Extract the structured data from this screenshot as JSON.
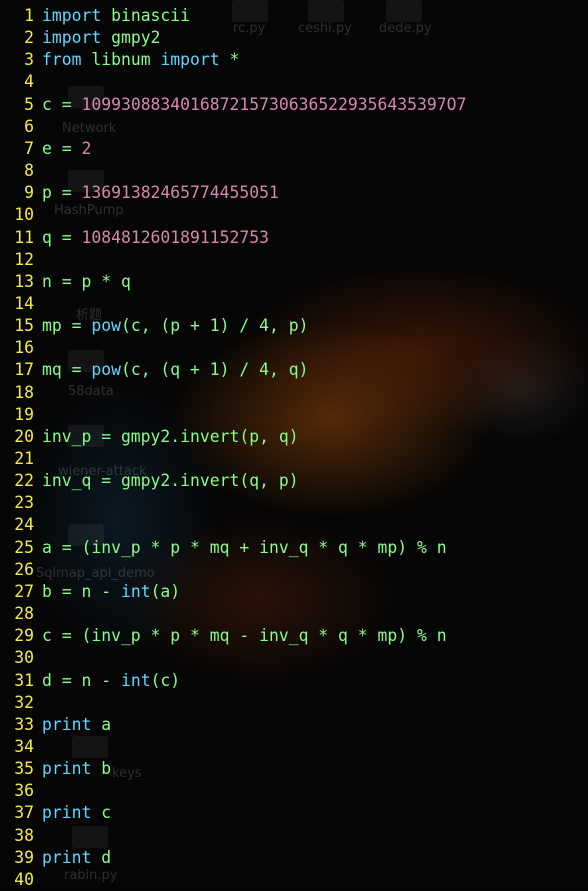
{
  "desktop_icons": [
    "rc.py",
    "ceshi.py",
    "dede.py",
    "Network",
    "HashPump",
    "析题",
    "58data",
    "wiener-attack",
    "Sqlmap_api_demo",
    "keys",
    "rabin.py"
  ],
  "lines": [
    {
      "n": "1",
      "tokens": [
        {
          "t": "import",
          "c": "kw"
        },
        {
          "t": " binascii",
          "c": "mod"
        }
      ]
    },
    {
      "n": "2",
      "tokens": [
        {
          "t": "import",
          "c": "kw"
        },
        {
          "t": " gmpy2",
          "c": "mod"
        }
      ]
    },
    {
      "n": "3",
      "tokens": [
        {
          "t": "from",
          "c": "kw"
        },
        {
          "t": " libnum ",
          "c": "mod"
        },
        {
          "t": "import",
          "c": "kw"
        },
        {
          "t": " *",
          "c": "mod"
        }
      ]
    },
    {
      "n": "4",
      "tokens": []
    },
    {
      "n": "5",
      "tokens": [
        {
          "t": "c = ",
          "c": "op"
        },
        {
          "t": "1099308834016872157306365229356435397O7",
          "c": "num"
        }
      ]
    },
    {
      "n": "6",
      "tokens": []
    },
    {
      "n": "7",
      "tokens": [
        {
          "t": "e = ",
          "c": "op"
        },
        {
          "t": "2",
          "c": "num"
        }
      ]
    },
    {
      "n": "8",
      "tokens": []
    },
    {
      "n": "9",
      "tokens": [
        {
          "t": "p = ",
          "c": "op"
        },
        {
          "t": "13691382465774455051",
          "c": "num"
        }
      ]
    },
    {
      "n": "10",
      "tokens": []
    },
    {
      "n": "11",
      "tokens": [
        {
          "t": "q = ",
          "c": "op"
        },
        {
          "t": "1084812601891152753",
          "c": "num"
        }
      ]
    },
    {
      "n": "12",
      "tokens": []
    },
    {
      "n": "13",
      "tokens": [
        {
          "t": "n = p * q",
          "c": "op"
        }
      ]
    },
    {
      "n": "14",
      "tokens": []
    },
    {
      "n": "15",
      "tokens": [
        {
          "t": "mp = ",
          "c": "op"
        },
        {
          "t": "pow",
          "c": "kw"
        },
        {
          "t": "(c, (p + 1) / 4, p)",
          "c": "op"
        }
      ]
    },
    {
      "n": "16",
      "tokens": []
    },
    {
      "n": "17",
      "tokens": [
        {
          "t": "mq = ",
          "c": "op"
        },
        {
          "t": "pow",
          "c": "kw"
        },
        {
          "t": "(c, (q + 1) / 4, q)",
          "c": "op"
        }
      ]
    },
    {
      "n": "18",
      "tokens": []
    },
    {
      "n": "19",
      "tokens": []
    },
    {
      "n": "20",
      "tokens": [
        {
          "t": "inv_p = gmpy2.invert(p, q)",
          "c": "op"
        }
      ]
    },
    {
      "n": "21",
      "tokens": []
    },
    {
      "n": "22",
      "tokens": [
        {
          "t": "inv_q = gmpy2.invert(q, p)",
          "c": "op"
        }
      ]
    },
    {
      "n": "23",
      "tokens": []
    },
    {
      "n": "24",
      "tokens": []
    },
    {
      "n": "25",
      "tokens": [
        {
          "t": "a = (inv_p * p * mq + inv_q * q * mp) % n",
          "c": "op"
        }
      ]
    },
    {
      "n": "26",
      "tokens": []
    },
    {
      "n": "27",
      "tokens": [
        {
          "t": "b = n - ",
          "c": "op"
        },
        {
          "t": "int",
          "c": "kw"
        },
        {
          "t": "(a)",
          "c": "op"
        }
      ]
    },
    {
      "n": "28",
      "tokens": []
    },
    {
      "n": "29",
      "tokens": [
        {
          "t": "c = (inv_p * p * mq - inv_q * q * mp) % n",
          "c": "op"
        }
      ]
    },
    {
      "n": "30",
      "tokens": []
    },
    {
      "n": "31",
      "tokens": [
        {
          "t": "d = n - ",
          "c": "op"
        },
        {
          "t": "int",
          "c": "kw"
        },
        {
          "t": "(c)",
          "c": "op"
        }
      ]
    },
    {
      "n": "32",
      "tokens": []
    },
    {
      "n": "33",
      "tokens": [
        {
          "t": "print",
          "c": "kw"
        },
        {
          "t": " a",
          "c": "op"
        }
      ]
    },
    {
      "n": "34",
      "tokens": []
    },
    {
      "n": "35",
      "tokens": [
        {
          "t": "print",
          "c": "kw"
        },
        {
          "t": " b",
          "c": "op"
        }
      ]
    },
    {
      "n": "36",
      "tokens": []
    },
    {
      "n": "37",
      "tokens": [
        {
          "t": "print",
          "c": "kw"
        },
        {
          "t": " c",
          "c": "op"
        }
      ]
    },
    {
      "n": "38",
      "tokens": []
    },
    {
      "n": "39",
      "tokens": [
        {
          "t": "print",
          "c": "kw"
        },
        {
          "t": " d",
          "c": "op"
        }
      ]
    },
    {
      "n": "40",
      "tokens": []
    }
  ],
  "colors": {
    "line_number": "#f5e94c",
    "keyword": "#5fd7ff",
    "code": "#87ff87",
    "number": "#d787af"
  }
}
